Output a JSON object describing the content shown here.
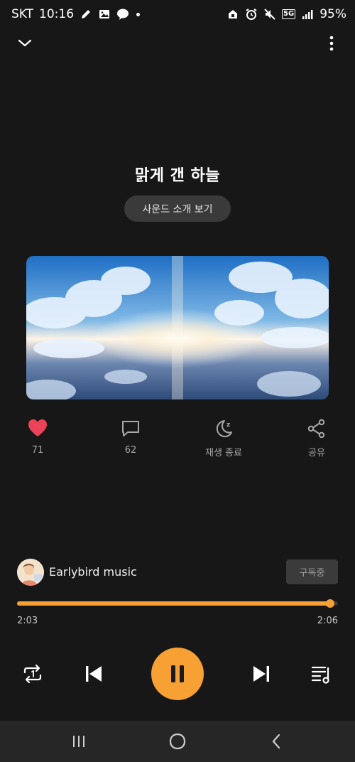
{
  "status": {
    "carrier": "SKT",
    "time": "10:16",
    "network": "5G",
    "battery": "95%",
    "left_icons": [
      "pen-icon",
      "gallery-icon",
      "kakaotalk-icon",
      "notification-dot"
    ],
    "right_icons": [
      "home-lock-icon",
      "alarm-icon",
      "mute-icon",
      "5g-signal-icon",
      "signal-bars-icon"
    ]
  },
  "track": {
    "title": "맑게 갠 하늘",
    "intro_button": "사운드 소개 보기"
  },
  "actions": {
    "likes": "71",
    "comments": "62",
    "sleep_timer": "재생 종료",
    "share": "공유"
  },
  "channel": {
    "name": "Earlybird music",
    "subscribe_label": "구독중"
  },
  "playback": {
    "current_time": "2:03",
    "total_time": "2:06",
    "progress": 0.976,
    "state": "playing"
  },
  "colors": {
    "accent": "#f7a033",
    "like": "#ee4258",
    "background": "#171717"
  }
}
